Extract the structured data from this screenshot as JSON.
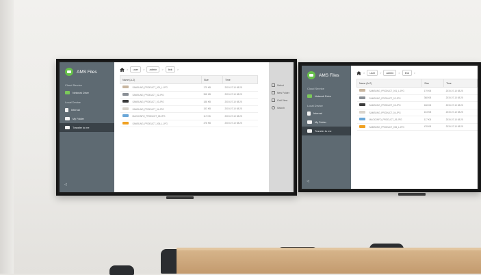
{
  "app": {
    "title": "AMS Files",
    "brand_color": "#66c04a",
    "sidebar_color": "#5e6a72"
  },
  "sidebar": {
    "sections": [
      {
        "label": "Cloud Service",
        "items": [
          {
            "label": "Network Drive",
            "icon": "cloud-drive-icon"
          }
        ]
      },
      {
        "label": "Local Device",
        "items": [
          {
            "label": "Internal",
            "icon": "storage-icon"
          },
          {
            "label": "My Folder",
            "icon": "folder-icon"
          },
          {
            "label": "Transfer to me",
            "icon": "transfer-folder-icon",
            "active": true
          }
        ]
      }
    ]
  },
  "breadcrumb": [
    "user",
    "admin",
    "link"
  ],
  "table": {
    "headers": [
      "Name (A-Z)",
      "Size",
      "Time"
    ],
    "rows": [
      {
        "name": "SAMSUNG_PRODUCT_001_L.JPG",
        "size": "179 KB",
        "time": "2019-07-10 08:25",
        "thumb": "#c8b6a0"
      },
      {
        "name": "SAMSUNG_PRODUCT_02.JPG",
        "size": "368 KB",
        "time": "2019-07-10 08:25",
        "thumb": "#8a8f95"
      },
      {
        "name": "SAMSUNG_PRODUCT_03.JPG",
        "size": "188 KB",
        "time": "2019-07-10 08:25",
        "thumb": "#3b3b3b"
      },
      {
        "name": "SAMSUNG_PRODUCT_04.JPG",
        "size": "153 KB",
        "time": "2019-07-10 08:25",
        "thumb": "#d9d4cc"
      },
      {
        "name": "MAGICINFO_PRODUCT_05.JPG",
        "size": "117 KB",
        "time": "2019-07-10 08:25",
        "thumb": "#6aa7d8"
      },
      {
        "name": "SAMSUNG_PRODUCT_006_L.JPG",
        "size": "478 KB",
        "time": "2019-07-10 08:25",
        "thumb": "#f0a020"
      }
    ]
  },
  "toolbar": {
    "items": [
      {
        "label": "Select",
        "icon": "select-icon"
      },
      {
        "label": "New Folder",
        "icon": "new-folder-icon"
      },
      {
        "label": "Grid View",
        "icon": "grid-view-icon"
      },
      {
        "label": "Search",
        "icon": "search-icon"
      }
    ]
  }
}
